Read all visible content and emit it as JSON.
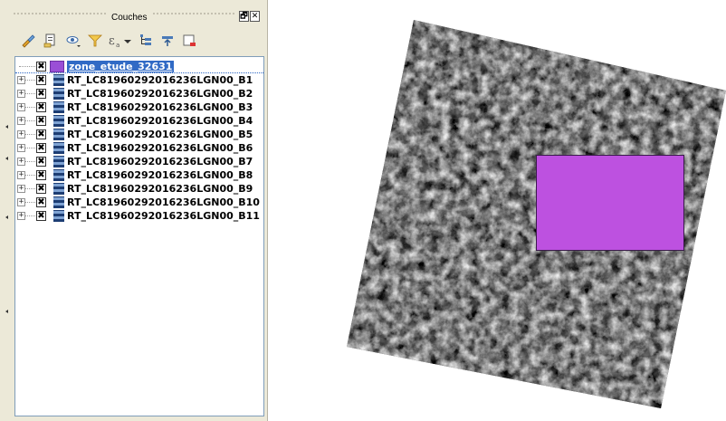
{
  "panel": {
    "title": "Couches",
    "restore_glyph": "🗗",
    "close_glyph": "✕"
  },
  "toolbar": {
    "icons": [
      "open-layer-styling-icon",
      "add-group-icon",
      "manage-visibility-icon",
      "filter-legend-icon",
      "filter-expression-icon",
      "expand-all-icon",
      "collapse-all-icon",
      "remove-layer-icon"
    ]
  },
  "layers": [
    {
      "name": "zone_etude_32631",
      "type": "vector",
      "checked": true,
      "selected": true
    },
    {
      "name": "RT_LC81960292016236LGN00_B1",
      "type": "raster",
      "checked": true
    },
    {
      "name": "RT_LC81960292016236LGN00_B2",
      "type": "raster",
      "checked": true
    },
    {
      "name": "RT_LC81960292016236LGN00_B3",
      "type": "raster",
      "checked": true
    },
    {
      "name": "RT_LC81960292016236LGN00_B4",
      "type": "raster",
      "checked": true
    },
    {
      "name": "RT_LC81960292016236LGN00_B5",
      "type": "raster",
      "checked": true
    },
    {
      "name": "RT_LC81960292016236LGN00_B6",
      "type": "raster",
      "checked": true
    },
    {
      "name": "RT_LC81960292016236LGN00_B7",
      "type": "raster",
      "checked": true
    },
    {
      "name": "RT_LC81960292016236LGN00_B8",
      "type": "raster",
      "checked": true
    },
    {
      "name": "RT_LC81960292016236LGN00_B9",
      "type": "raster",
      "checked": true
    },
    {
      "name": "RT_LC81960292016236LGN00_B10",
      "type": "raster",
      "checked": true
    },
    {
      "name": "RT_LC81960292016236LGN00_B11",
      "type": "raster",
      "checked": true
    }
  ],
  "check_glyph": "✖",
  "expander_glyph": "+",
  "colors": {
    "selection": "#316ac5",
    "aoi_fill": "#bd51e0",
    "vector_icon": "#9a4fd6"
  }
}
